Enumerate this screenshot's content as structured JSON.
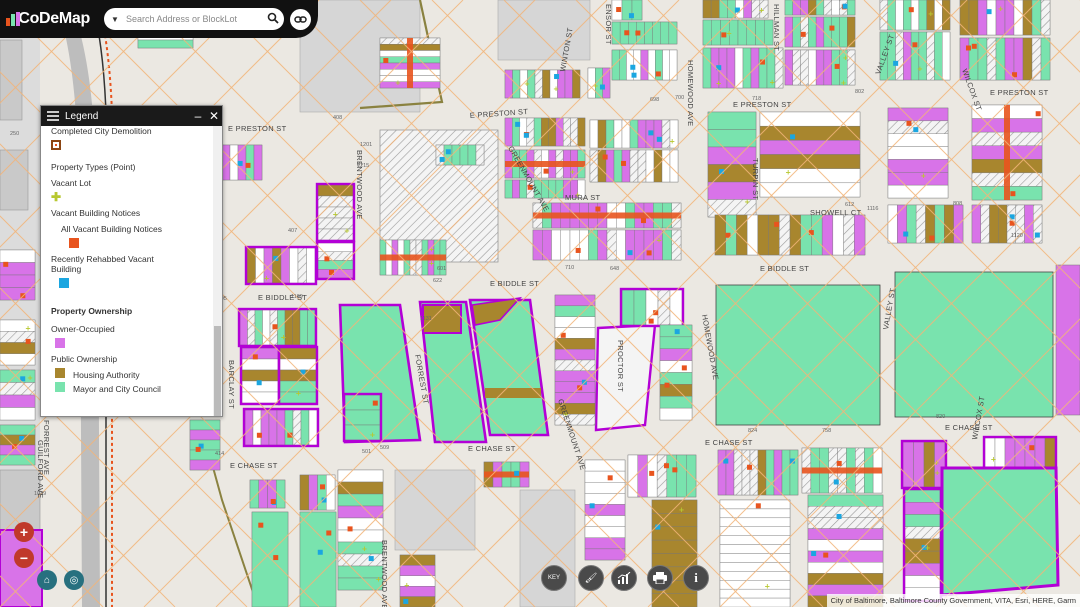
{
  "app": {
    "name": "CoDeMap"
  },
  "search": {
    "placeholder": "Search Address or BlockLot",
    "dropdown_icon": "triangle-down-icon",
    "search_icon": "magnifier-icon",
    "link_icon": "link-icon"
  },
  "legend": {
    "title": "Legend",
    "items": [
      {
        "label": "Completed City Demolition",
        "swatch": "#8b4513",
        "type": "square-outline"
      },
      {
        "label": "Property Types (Point)",
        "type": "header"
      },
      {
        "label": "Vacant Lot",
        "swatch": "#c8d84a",
        "type": "cross"
      },
      {
        "label": "Vacant Building Notices",
        "type": "subheader"
      },
      {
        "label": "All Vacant Building Notices",
        "swatch": "#e8541e",
        "type": "square"
      },
      {
        "label": "Recently Rehabbed Vacant Building",
        "swatch": "#1ba6e0",
        "type": "square"
      },
      {
        "label": "Property Ownership",
        "type": "bold-header"
      },
      {
        "label": "Owner-Occupied",
        "swatch": "#d873e8",
        "type": "square"
      },
      {
        "label": "Public Ownership",
        "type": "subheader"
      },
      {
        "label": "Housing Authority",
        "swatch": "#a8862e",
        "type": "square"
      },
      {
        "label": "Mayor and City Council",
        "swatch": "#79e3ae",
        "type": "square"
      }
    ]
  },
  "map": {
    "streets": {
      "e_preston_st_1": "E PRESTON ST",
      "e_preston_st_2": "E PRESTON ST",
      "e_preston_st_3": "E PRESTON ST",
      "e_preston_st_4": "E PRESTON ST",
      "e_biddle_st_1": "E BIDDLE ST",
      "e_biddle_st_2": "E BIDDLE ST",
      "e_biddle_st_3": "E BIDDLE ST",
      "e_chase_st_1": "E CHASE ST",
      "e_chase_st_2": "E CHASE ST",
      "e_chase_st_3": "E CHASE ST",
      "e_chase_st_4": "E CHASE ST",
      "guilford_ave": "GUILFORD AVE",
      "barclay_st": "BARCLAY ST",
      "brentwood_ave_1": "BRENTWOOD AVE",
      "brentwood_ave_2": "BRENTWOOD AVE",
      "greenmount_ave_1": "GREENMOUNT AVE",
      "greenmount_ave_2": "GREENMOUNT AVE",
      "forrest_st": "FORREST ST",
      "ensor_st": "ENSOR ST",
      "hillman_st": "HILLMAN ST",
      "homewood_ave_1": "HOMEWOOD AVE",
      "homewood_ave_2": "HOMEWOOD AVE",
      "valley_st_1": "VALLEY ST",
      "valley_st_2": "VALLEY ST",
      "wilcox_st_1": "WILCOX ST",
      "wilcox_st_2": "WILCOX ST",
      "turpin_st": "TURPIN ST",
      "showell_ct": "SHOWELL CT",
      "mura_st": "MURA ST",
      "proctor_st": "PROCTOR ST",
      "winton_st": "WINTON ST",
      "forrest_ave": "FORREST AVE"
    },
    "numbers": [
      "250",
      "408",
      "1201",
      "1215",
      "698",
      "700",
      "718",
      "802",
      "601",
      "622",
      "648",
      "710",
      "612",
      "1116",
      "1120",
      "407",
      "1105",
      "1109",
      "414",
      "501",
      "509",
      "758",
      "824",
      "820",
      "808",
      "1131",
      "1039"
    ]
  },
  "controls": {
    "zoom_in": "+",
    "zoom_out": "−",
    "home_icon": "home-icon",
    "locate_icon": "locate-icon",
    "tools": [
      {
        "name": "key-icon",
        "label": "KEY"
      },
      {
        "name": "paint-brush-icon",
        "label": ""
      },
      {
        "name": "chart-icon",
        "label": ""
      },
      {
        "name": "printer-icon",
        "label": ""
      },
      {
        "name": "info-icon",
        "label": "i"
      }
    ]
  },
  "attribution": "City of Baltimore, Baltimore County Government, VITA, Esri, HERE, Garm",
  "colors": {
    "owner": "#d873e8",
    "housing": "#a8862e",
    "council": "#79e3ae",
    "vacant_notice": "#e8541e",
    "rehab": "#1ba6e0",
    "outline": "#b300d6",
    "grid": "#f2b57a"
  }
}
